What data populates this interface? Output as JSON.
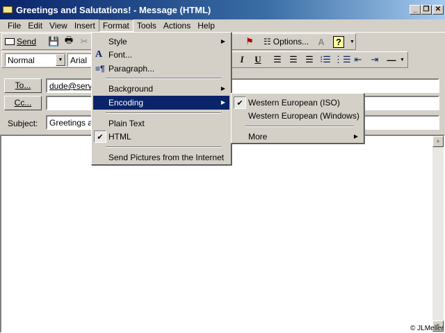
{
  "window": {
    "title": "Greetings and Salutations! - Message (HTML)",
    "minimize": "_",
    "restore": "❐",
    "close": "✕"
  },
  "menubar": [
    "File",
    "Edit",
    "View",
    "Insert",
    "Format",
    "Tools",
    "Actions",
    "Help"
  ],
  "toolbar": {
    "send": "Send",
    "options": "Options...",
    "help": "?"
  },
  "formatting": {
    "style": "Normal",
    "font": "Arial",
    "italic": "I",
    "underline": "U"
  },
  "header": {
    "to_button": "To...",
    "cc_button": "Cc...",
    "subject_label": "Subject:",
    "to_value": "dude@serve",
    "cc_value": "",
    "subject_value": "Greetings an"
  },
  "format_menu": {
    "style": "Style",
    "font": "Font...",
    "paragraph": "Paragraph...",
    "background": "Background",
    "encoding": "Encoding",
    "plain_text": "Plain Text",
    "html": "HTML",
    "send_pictures": "Send Pictures from the Internet"
  },
  "encoding_menu": {
    "iso": "Western European (ISO)",
    "windows": "Western European (Windows)",
    "more": "More"
  },
  "watermark": "© JLMeller"
}
